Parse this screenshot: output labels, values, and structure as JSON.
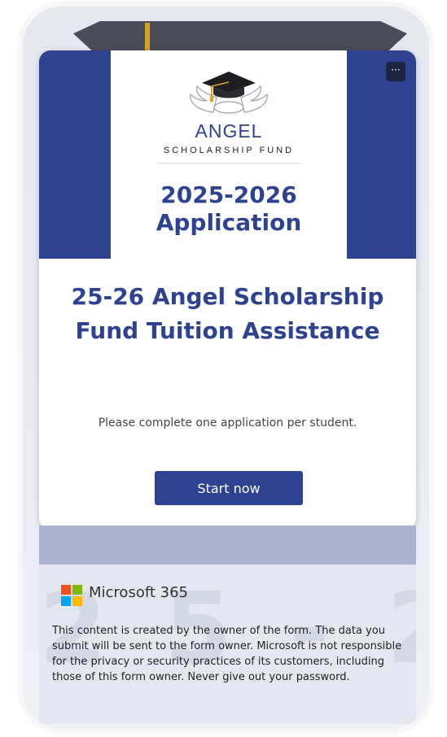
{
  "banner": {
    "org_name": "ANGEL",
    "org_sub": "SCHOLARSHIP FUND",
    "year_line1": "2025-2026",
    "year_line2": "Application",
    "menu_label": "···"
  },
  "form": {
    "title": "25-26 Angel Scholarship Fund Tuition Assistance",
    "subtitle": "Please complete one application per student.",
    "start_label": "Start now"
  },
  "footer": {
    "ghost_text": "25-26",
    "brand": "Microsoft 365",
    "disclaimer": "This content is created by the owner of the form. The data you submit will be sent to the form owner. Microsoft is not responsible for the privacy or security practices of its customers, including those of this form owner. Never give out your password."
  },
  "colors": {
    "brand_blue": "#2d4392",
    "strip": "#a9b2d0",
    "ms_red": "#f25022",
    "ms_green": "#7fba00",
    "ms_blue": "#00a4ef",
    "ms_yellow": "#ffb900"
  },
  "icons": [
    "graduation-cap-icon",
    "angel-wings-icon",
    "more-options-icon",
    "microsoft-logo-icon"
  ]
}
